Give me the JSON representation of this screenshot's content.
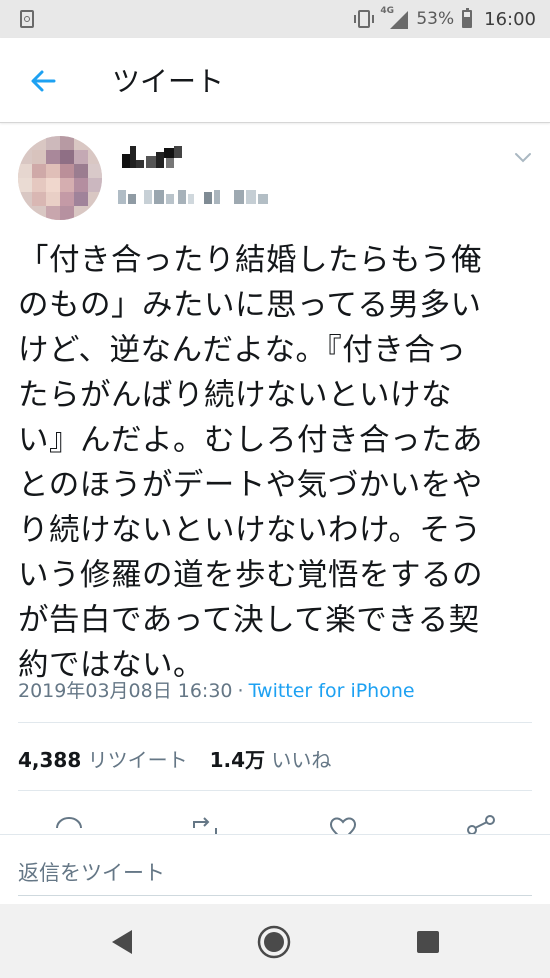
{
  "status_bar": {
    "network": "4G",
    "battery": "53%",
    "time": "16:00"
  },
  "app_bar": {
    "title": "ツイート",
    "back_icon": "arrow-left-icon"
  },
  "tweet": {
    "body": "「付き合ったり結婚したらもう俺\nのもの」みたいに思ってる男多い\nけど、逆なんだよな。『付き合っ\nたらがんばり続けないといけな\nい』んだよ。むしろ付き合ったあ\nとのほうがデートや気づかいをや\nり続けないといけないわけ。そう\nいう修羅の道を歩む覚悟をするの\nが告白であって決して楽できる契\n約ではない。",
    "timestamp": "2019年03月08日 16:30",
    "separator": "·",
    "source": "Twitter for iPhone",
    "retweet_count": "4,388",
    "retweet_label": "リツイート",
    "like_count": "1.4万",
    "like_label": "いいね"
  },
  "reply": {
    "placeholder": "返信をツイート"
  },
  "colors": {
    "accent": "#1da1f2",
    "secondary_text": "#657786",
    "primary_text": "#14171a"
  }
}
